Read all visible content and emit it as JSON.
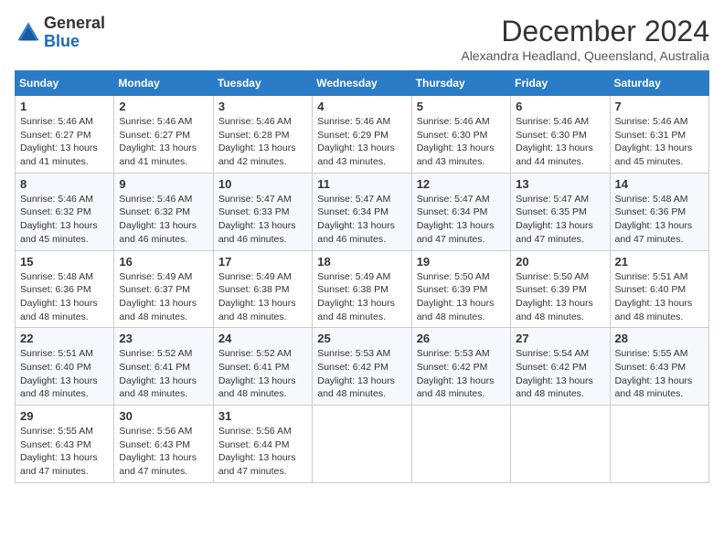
{
  "header": {
    "logo_general": "General",
    "logo_blue": "Blue",
    "main_title": "December 2024",
    "sub_title": "Alexandra Headland, Queensland, Australia"
  },
  "days_of_week": [
    "Sunday",
    "Monday",
    "Tuesday",
    "Wednesday",
    "Thursday",
    "Friday",
    "Saturday"
  ],
  "weeks": [
    [
      {
        "day": "1",
        "sunrise": "5:46 AM",
        "sunset": "6:27 PM",
        "daylight": "13 hours and 41 minutes."
      },
      {
        "day": "2",
        "sunrise": "5:46 AM",
        "sunset": "6:27 PM",
        "daylight": "13 hours and 41 minutes."
      },
      {
        "day": "3",
        "sunrise": "5:46 AM",
        "sunset": "6:28 PM",
        "daylight": "13 hours and 42 minutes."
      },
      {
        "day": "4",
        "sunrise": "5:46 AM",
        "sunset": "6:29 PM",
        "daylight": "13 hours and 43 minutes."
      },
      {
        "day": "5",
        "sunrise": "5:46 AM",
        "sunset": "6:30 PM",
        "daylight": "13 hours and 43 minutes."
      },
      {
        "day": "6",
        "sunrise": "5:46 AM",
        "sunset": "6:30 PM",
        "daylight": "13 hours and 44 minutes."
      },
      {
        "day": "7",
        "sunrise": "5:46 AM",
        "sunset": "6:31 PM",
        "daylight": "13 hours and 45 minutes."
      }
    ],
    [
      {
        "day": "8",
        "sunrise": "5:46 AM",
        "sunset": "6:32 PM",
        "daylight": "13 hours and 45 minutes."
      },
      {
        "day": "9",
        "sunrise": "5:46 AM",
        "sunset": "6:32 PM",
        "daylight": "13 hours and 46 minutes."
      },
      {
        "day": "10",
        "sunrise": "5:47 AM",
        "sunset": "6:33 PM",
        "daylight": "13 hours and 46 minutes."
      },
      {
        "day": "11",
        "sunrise": "5:47 AM",
        "sunset": "6:34 PM",
        "daylight": "13 hours and 46 minutes."
      },
      {
        "day": "12",
        "sunrise": "5:47 AM",
        "sunset": "6:34 PM",
        "daylight": "13 hours and 47 minutes."
      },
      {
        "day": "13",
        "sunrise": "5:47 AM",
        "sunset": "6:35 PM",
        "daylight": "13 hours and 47 minutes."
      },
      {
        "day": "14",
        "sunrise": "5:48 AM",
        "sunset": "6:36 PM",
        "daylight": "13 hours and 47 minutes."
      }
    ],
    [
      {
        "day": "15",
        "sunrise": "5:48 AM",
        "sunset": "6:36 PM",
        "daylight": "13 hours and 48 minutes."
      },
      {
        "day": "16",
        "sunrise": "5:49 AM",
        "sunset": "6:37 PM",
        "daylight": "13 hours and 48 minutes."
      },
      {
        "day": "17",
        "sunrise": "5:49 AM",
        "sunset": "6:38 PM",
        "daylight": "13 hours and 48 minutes."
      },
      {
        "day": "18",
        "sunrise": "5:49 AM",
        "sunset": "6:38 PM",
        "daylight": "13 hours and 48 minutes."
      },
      {
        "day": "19",
        "sunrise": "5:50 AM",
        "sunset": "6:39 PM",
        "daylight": "13 hours and 48 minutes."
      },
      {
        "day": "20",
        "sunrise": "5:50 AM",
        "sunset": "6:39 PM",
        "daylight": "13 hours and 48 minutes."
      },
      {
        "day": "21",
        "sunrise": "5:51 AM",
        "sunset": "6:40 PM",
        "daylight": "13 hours and 48 minutes."
      }
    ],
    [
      {
        "day": "22",
        "sunrise": "5:51 AM",
        "sunset": "6:40 PM",
        "daylight": "13 hours and 48 minutes."
      },
      {
        "day": "23",
        "sunrise": "5:52 AM",
        "sunset": "6:41 PM",
        "daylight": "13 hours and 48 minutes."
      },
      {
        "day": "24",
        "sunrise": "5:52 AM",
        "sunset": "6:41 PM",
        "daylight": "13 hours and 48 minutes."
      },
      {
        "day": "25",
        "sunrise": "5:53 AM",
        "sunset": "6:42 PM",
        "daylight": "13 hours and 48 minutes."
      },
      {
        "day": "26",
        "sunrise": "5:53 AM",
        "sunset": "6:42 PM",
        "daylight": "13 hours and 48 minutes."
      },
      {
        "day": "27",
        "sunrise": "5:54 AM",
        "sunset": "6:42 PM",
        "daylight": "13 hours and 48 minutes."
      },
      {
        "day": "28",
        "sunrise": "5:55 AM",
        "sunset": "6:43 PM",
        "daylight": "13 hours and 48 minutes."
      }
    ],
    [
      {
        "day": "29",
        "sunrise": "5:55 AM",
        "sunset": "6:43 PM",
        "daylight": "13 hours and 47 minutes."
      },
      {
        "day": "30",
        "sunrise": "5:56 AM",
        "sunset": "6:43 PM",
        "daylight": "13 hours and 47 minutes."
      },
      {
        "day": "31",
        "sunrise": "5:56 AM",
        "sunset": "6:44 PM",
        "daylight": "13 hours and 47 minutes."
      },
      null,
      null,
      null,
      null
    ]
  ],
  "labels": {
    "sunrise_label": "Sunrise:",
    "sunset_label": "Sunset:",
    "daylight_label": "Daylight:"
  }
}
